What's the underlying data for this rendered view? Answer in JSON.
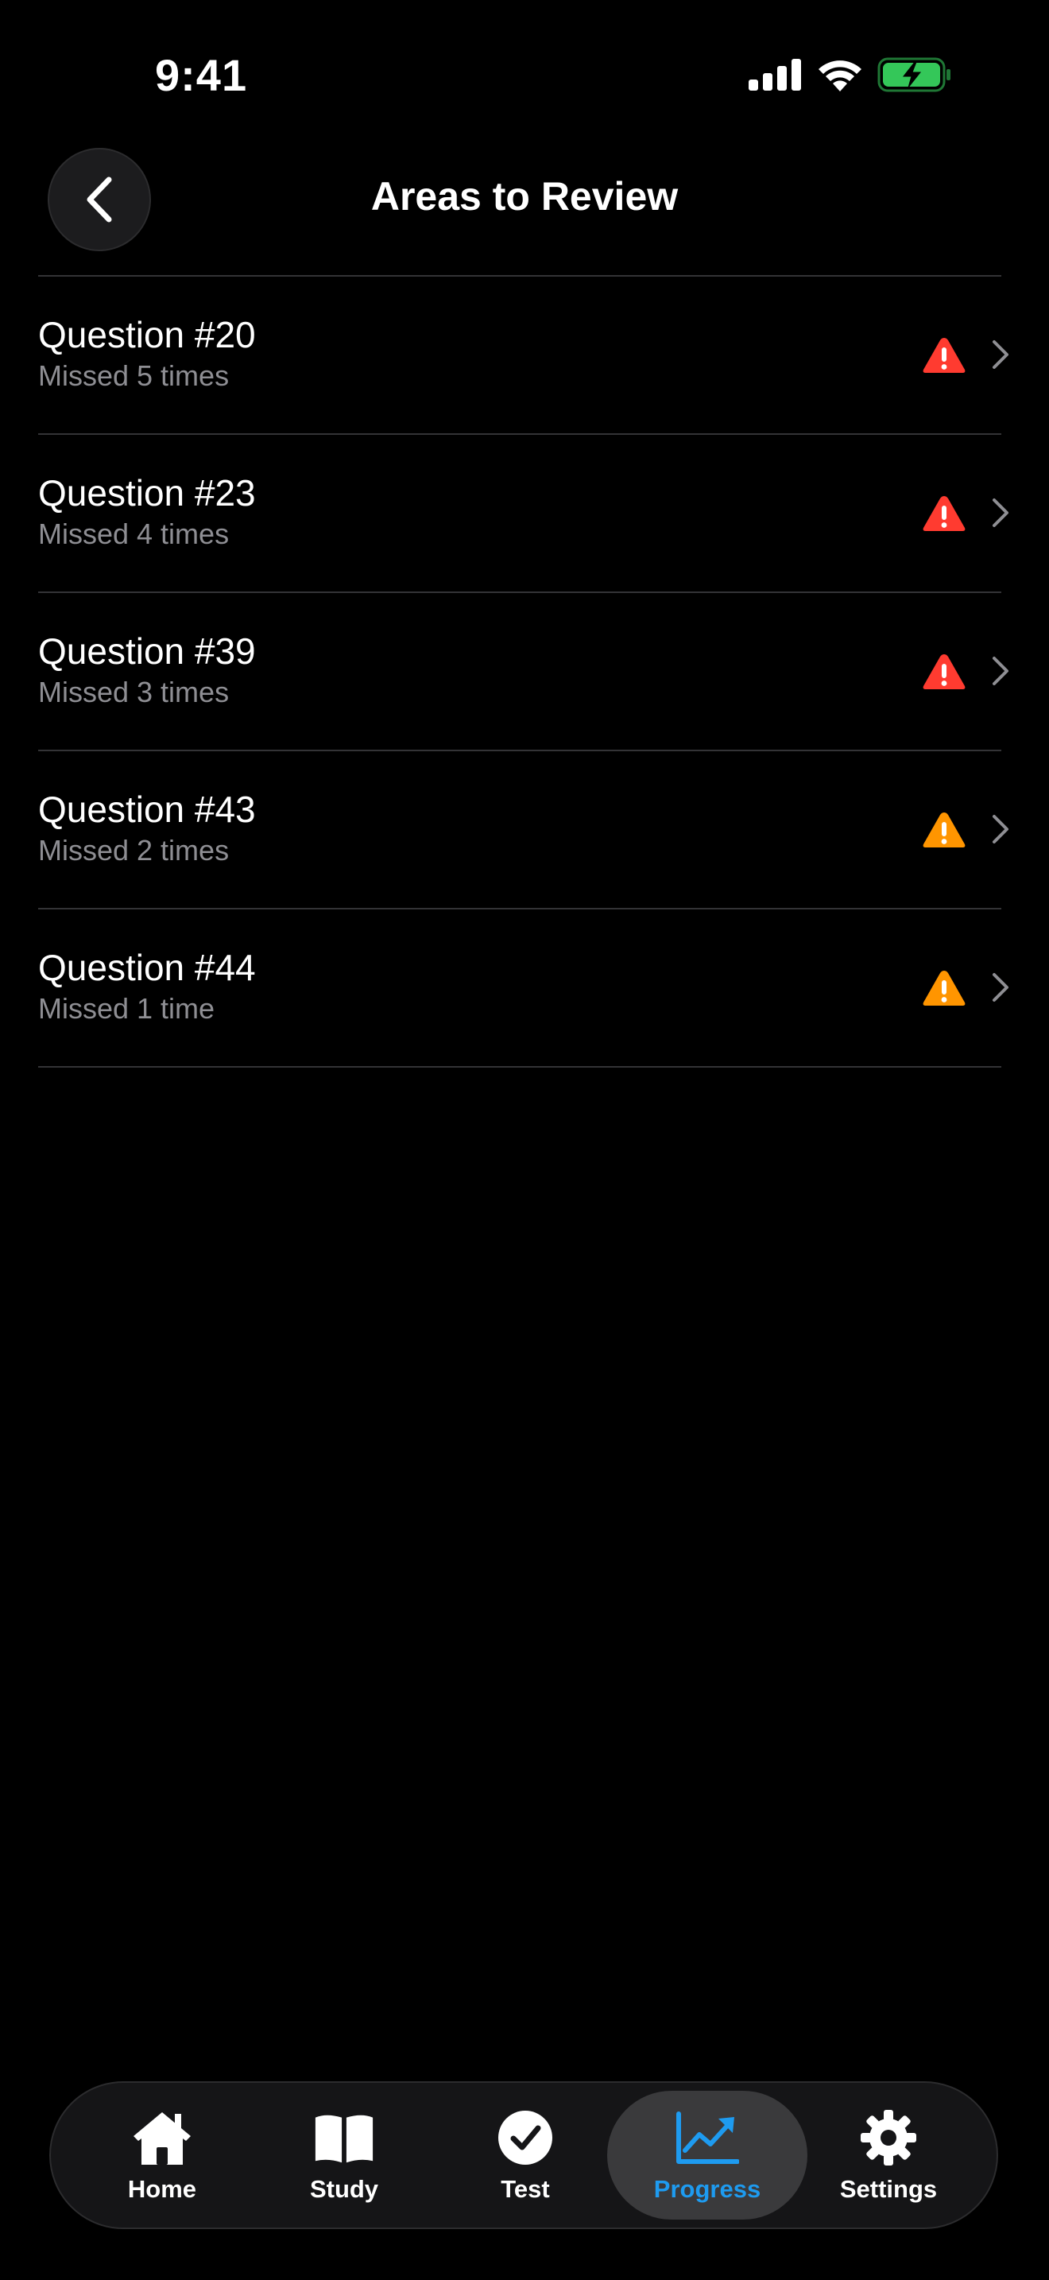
{
  "status_bar": {
    "time": "9:41",
    "signal_icon": "cellular-signal-icon",
    "wifi_icon": "wifi-icon",
    "battery_icon": "battery-charging-icon",
    "battery_color": "#34c759"
  },
  "header": {
    "back_icon": "chevron-left-icon",
    "title": "Areas to Review"
  },
  "review_items": [
    {
      "title": "Question #20",
      "subtitle": "Missed 5 times",
      "severity": "high",
      "warning_color": "#ff3b30"
    },
    {
      "title": "Question #23",
      "subtitle": "Missed 4 times",
      "severity": "high",
      "warning_color": "#ff3b30"
    },
    {
      "title": "Question #39",
      "subtitle": "Missed 3 times",
      "severity": "high",
      "warning_color": "#ff3b30"
    },
    {
      "title": "Question #43",
      "subtitle": "Missed 2 times",
      "severity": "medium",
      "warning_color": "#ff9500"
    },
    {
      "title": "Question #44",
      "subtitle": "Missed 1 time",
      "severity": "medium",
      "warning_color": "#ff9500"
    }
  ],
  "tab_bar": {
    "active_color": "#1e9bf0",
    "tabs": [
      {
        "label": "Home",
        "icon": "house-icon",
        "active": false
      },
      {
        "label": "Study",
        "icon": "open-book-icon",
        "active": false
      },
      {
        "label": "Test",
        "icon": "checkmark-circle-icon",
        "active": false
      },
      {
        "label": "Progress",
        "icon": "trend-chart-icon",
        "active": true
      },
      {
        "label": "Settings",
        "icon": "gear-icon",
        "active": false
      }
    ]
  }
}
